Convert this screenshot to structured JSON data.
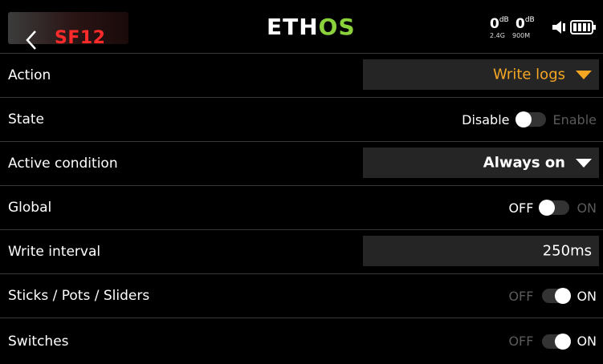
{
  "header": {
    "title": "SF12",
    "logo_prefix": "ETH",
    "logo_suffix": "OS",
    "rssi_24": "0",
    "rssi_24_unit": "dB",
    "rssi_24_label": "2.4G",
    "rssi_900": "0",
    "rssi_900_unit": "dB",
    "rssi_900_label": "900M",
    "icons": [
      "back-chevron-icon",
      "speaker-icon",
      "battery-icon"
    ]
  },
  "rows": {
    "action": {
      "label": "Action",
      "value": "Write logs"
    },
    "state": {
      "label": "State",
      "off_label": "Disable",
      "on_label": "Enable",
      "enabled": false
    },
    "active_condition": {
      "label": "Active condition",
      "value": "Always on"
    },
    "global": {
      "label": "Global",
      "off_label": "OFF",
      "on_label": "ON",
      "enabled": false
    },
    "write_interval": {
      "label": "Write interval",
      "value": "250ms"
    },
    "sticks": {
      "label": "Sticks / Pots / Sliders",
      "off_label": "OFF",
      "on_label": "ON",
      "enabled": true
    },
    "switches": {
      "label": "Switches",
      "off_label": "OFF",
      "on_label": "ON",
      "enabled": true
    }
  },
  "colors": {
    "accent_orange": "#f5a623",
    "title_red": "#ff2a2a",
    "logo_green": "#8bd13c",
    "field_bg": "#252525",
    "background": "#000000"
  }
}
